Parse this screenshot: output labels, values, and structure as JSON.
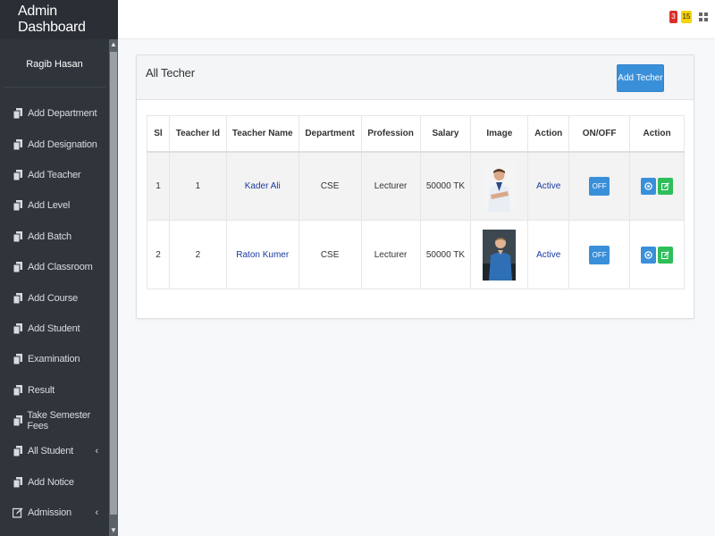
{
  "app": {
    "title": "Admin Dashboard"
  },
  "user": {
    "name": "Ragib Hasan"
  },
  "sidebar": {
    "items": [
      {
        "label": "Add Department",
        "icon": "copy-icon"
      },
      {
        "label": "Add Designation",
        "icon": "copy-icon"
      },
      {
        "label": "Add Teacher",
        "icon": "copy-icon"
      },
      {
        "label": "Add Level",
        "icon": "copy-icon"
      },
      {
        "label": "Add Batch",
        "icon": "copy-icon"
      },
      {
        "label": "Add Classroom",
        "icon": "copy-icon"
      },
      {
        "label": "Add Course",
        "icon": "copy-icon"
      },
      {
        "label": "Add Student",
        "icon": "copy-icon"
      },
      {
        "label": "Examination",
        "icon": "copy-icon"
      },
      {
        "label": "Result",
        "icon": "copy-icon"
      },
      {
        "label": "Take Semester Fees",
        "icon": "copy-icon"
      },
      {
        "label": "All Student",
        "icon": "copy-icon",
        "expandable": true
      },
      {
        "label": "Add Notice",
        "icon": "copy-icon"
      },
      {
        "label": "Admission",
        "icon": "edit-icon",
        "expandable": true
      }
    ]
  },
  "topbar": {
    "badge_red": "3",
    "badge_yellow": "15",
    "colors": {
      "red": "#d9302a",
      "yellow": "#f5d20c"
    }
  },
  "panel": {
    "title": "All Techer",
    "add_button": "Add Techer"
  },
  "table": {
    "headers": [
      "Sl",
      "Teacher Id",
      "Teacher Name",
      "Department",
      "Profession",
      "Salary",
      "Image",
      "Action",
      "ON/OFF",
      "Action"
    ],
    "rows": [
      {
        "sl": "1",
        "id": "1",
        "name": "Kader Ali",
        "department": "CSE",
        "profession": "Lecturer",
        "salary": "50000 TK",
        "status": "Active",
        "toggle": "OFF"
      },
      {
        "sl": "2",
        "id": "2",
        "name": "Raton Kumer",
        "department": "CSE",
        "profession": "Lecturer",
        "salary": "50000 TK",
        "status": "Active",
        "toggle": "OFF"
      }
    ]
  },
  "colors": {
    "sidebar_bg": "#2f353b",
    "primary": "#3a8fd9",
    "success": "#2fbf5a",
    "link": "#1a3aa0"
  }
}
